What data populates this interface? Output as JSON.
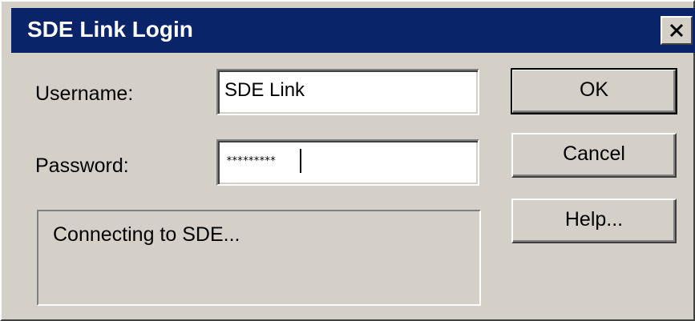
{
  "window": {
    "title": "SDE Link Login",
    "close_icon": "close-icon"
  },
  "form": {
    "username_label": "Username:",
    "username_value": "SDE Link",
    "password_label": "Password:",
    "password_value": "*********"
  },
  "status": {
    "text": "Connecting to SDE..."
  },
  "buttons": {
    "ok_label": "OK",
    "cancel_label": "Cancel",
    "help_label": "Help..."
  },
  "colors": {
    "titlebar": "#0a246a",
    "dialog_face": "#d4d0c8",
    "field_bg": "#ffffff"
  }
}
